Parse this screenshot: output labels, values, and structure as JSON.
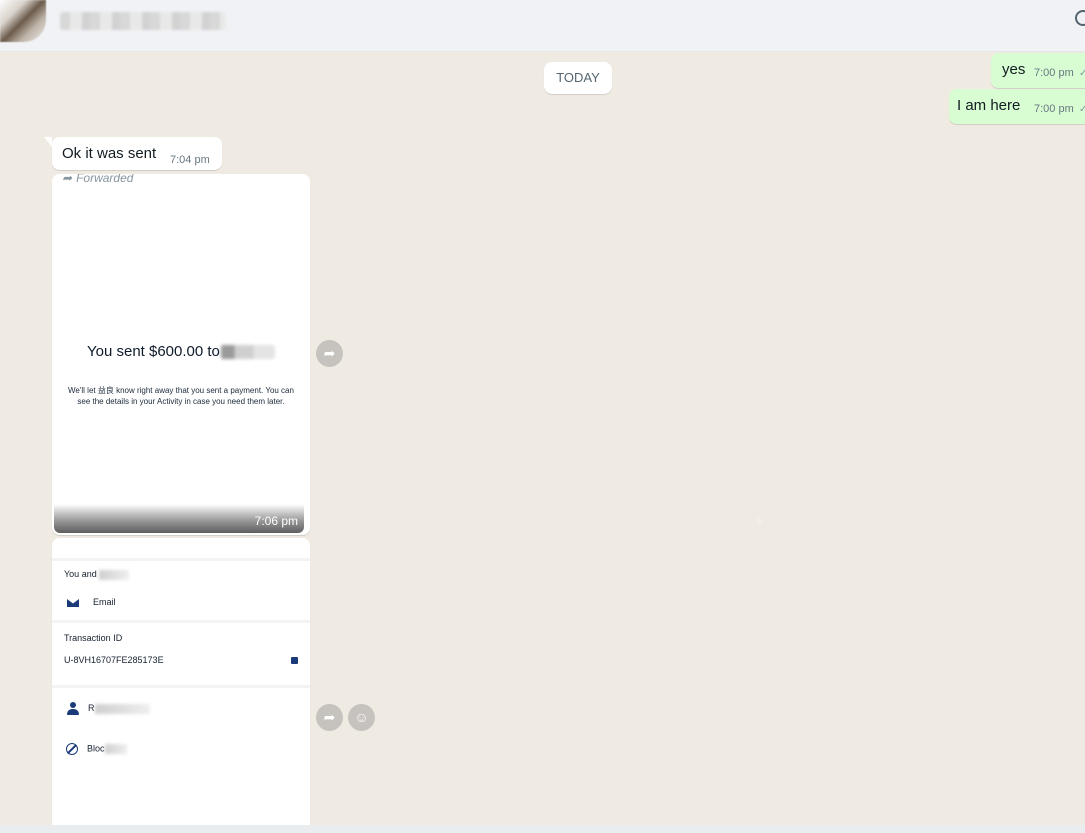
{
  "header": {
    "name_blurred": true
  },
  "chat": {
    "day_label": "TODAY",
    "messages": [
      {
        "text": "yes",
        "time": "7:00 pm",
        "dir": "out"
      },
      {
        "text": "I am here",
        "time": "7:00 pm",
        "dir": "out"
      },
      {
        "text": "Ok it was sent",
        "time": "7:04 pm",
        "dir": "in"
      }
    ],
    "image1": {
      "forwarded_label": "Forwarded",
      "title": "You sent $600.00 to",
      "desc": "We'll let 益良 know right away that you sent a payment. You can see the details in your Activity in case you need them later.",
      "time": "7:06 pm"
    },
    "image2": {
      "you_and": "You and",
      "email": "Email",
      "transaction_label": "Transaction ID",
      "transaction_id": "U-8VH16707FE285173E",
      "row_r": "R",
      "row_block": "Bloc"
    }
  },
  "colors": {
    "chat_bg": "#efeae2",
    "outgoing_bubble": "#d9fdd3",
    "incoming_bubble": "#ffffff",
    "header_bg": "#f0f2f5"
  },
  "icons": [
    "search-icon",
    "forward-icon",
    "emoji-icon",
    "double-check-icon",
    "mail-icon",
    "person-icon",
    "block-icon",
    "copy-icon"
  ]
}
